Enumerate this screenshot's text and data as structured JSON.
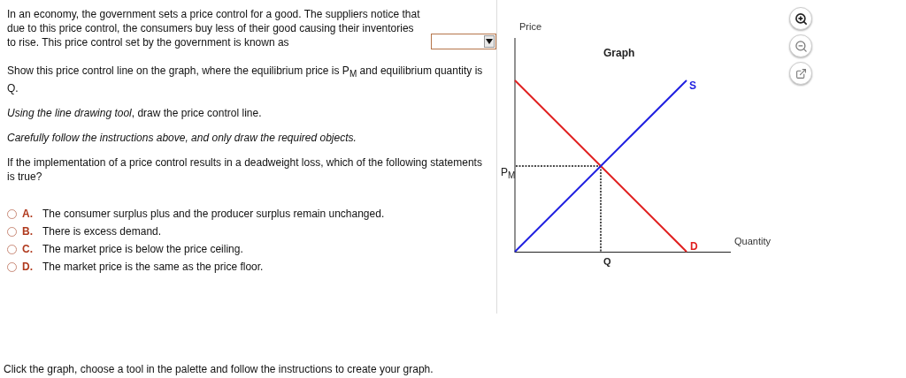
{
  "question": {
    "paragraphs": [
      {
        "text": "In an economy, the government sets a price control for a good. The suppliers notice that due to this price control, the consumers buy less of their good causing their inventories to rise. This price control set by the government is known as",
        "kind": "dropdown"
      },
      {
        "text": "Show this price control line on the graph, where the equilibrium price is P$_{M}$ and equilibrium quantity is Q.",
        "kind": "plain"
      },
      {
        "text": "*Using the line drawing tool*, draw the price control line.",
        "kind": "plain"
      },
      {
        "text": "Carefully follow the instructions above, and only draw the required objects.",
        "kind": "italic"
      },
      {
        "text": "If the implementation of a price control results in a deadweight loss, which of the following statements is true?",
        "kind": "plain"
      }
    ],
    "choices": [
      {
        "letter": "A.",
        "text": "The consumer surplus plus and the producer surplus remain unchanged.",
        "selected": false
      },
      {
        "letter": "B.",
        "text": "There is excess demand.",
        "selected": false
      },
      {
        "letter": "C.",
        "text": "The market price is below the price ceiling.",
        "selected": false
      },
      {
        "letter": "D.",
        "text": "The market price is the same as the price floor.",
        "selected": false
      }
    ]
  },
  "graph": {
    "title": "Graph",
    "y_axis_label": "Price",
    "x_axis_label": "Quantity",
    "supply_label": "S",
    "demand_label": "D",
    "price_label": "P$_{M}$",
    "quantity_label": "Q"
  },
  "instruction": "Click the graph, choose a tool in the palette and follow the instructions to create your graph."
}
